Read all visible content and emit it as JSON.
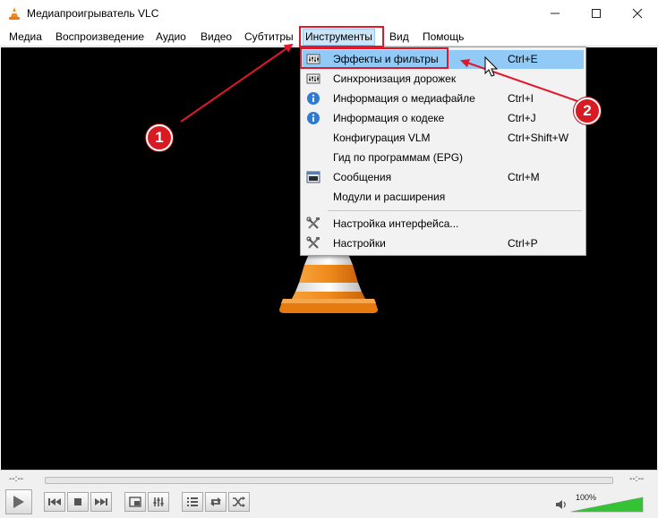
{
  "window": {
    "title": "Медиапроигрыватель VLC",
    "minimize": "—",
    "maximize": "☐",
    "close": "✕",
    "icon": "vlc-cone-icon"
  },
  "menubar": {
    "items": [
      "Медиа",
      "Воспроизведение",
      "Аудио",
      "Видео",
      "Субтитры",
      "Инструменты",
      "Вид",
      "Помощь"
    ],
    "active": "Инструменты"
  },
  "tools_menu": {
    "items": [
      {
        "label": "Эффекты и фильтры",
        "shortcut": "Ctrl+E",
        "icon": "equalizer-icon",
        "highlighted": true
      },
      {
        "label": "Синхронизация дорожек",
        "shortcut": "",
        "icon": "equalizer-icon"
      },
      {
        "label": "Информация о медиафайле",
        "shortcut": "Ctrl+I",
        "icon": "info-icon"
      },
      {
        "label": "Информация о кодеке",
        "shortcut": "Ctrl+J",
        "icon": "info-icon"
      },
      {
        "label": "Конфигурация VLM",
        "shortcut": "Ctrl+Shift+W",
        "icon": ""
      },
      {
        "label": "Гид по программам (EPG)",
        "shortcut": "",
        "icon": ""
      },
      {
        "label": "Сообщения",
        "shortcut": "Ctrl+M",
        "icon": "terminal-icon"
      },
      {
        "label": "Модули и расширения",
        "shortcut": "",
        "icon": ""
      },
      {
        "label": "Настройка интерфейса...",
        "shortcut": "",
        "icon": "tools-icon"
      },
      {
        "label": "Настройки",
        "shortcut": "Ctrl+P",
        "icon": "tools-icon"
      }
    ]
  },
  "annotations": {
    "badge1": "1",
    "badge2": "2",
    "color": "#e0182a"
  },
  "controls": {
    "elapsed": "--:--",
    "remaining": "--:--",
    "volume_label": "100%",
    "volume_level": 1.0,
    "buttons": [
      "play-icon",
      "previous-icon",
      "stop-icon",
      "next-icon",
      "fullscreen-icon",
      "extended-settings-icon",
      "playlist-icon",
      "loop-icon",
      "shuffle-icon",
      "speaker-icon"
    ]
  },
  "colors": {
    "menu_highlight": "#91c9f7",
    "active_menu": "#cce4f7",
    "video_bg": "#000000",
    "cone_orange": "#f08a1c"
  }
}
